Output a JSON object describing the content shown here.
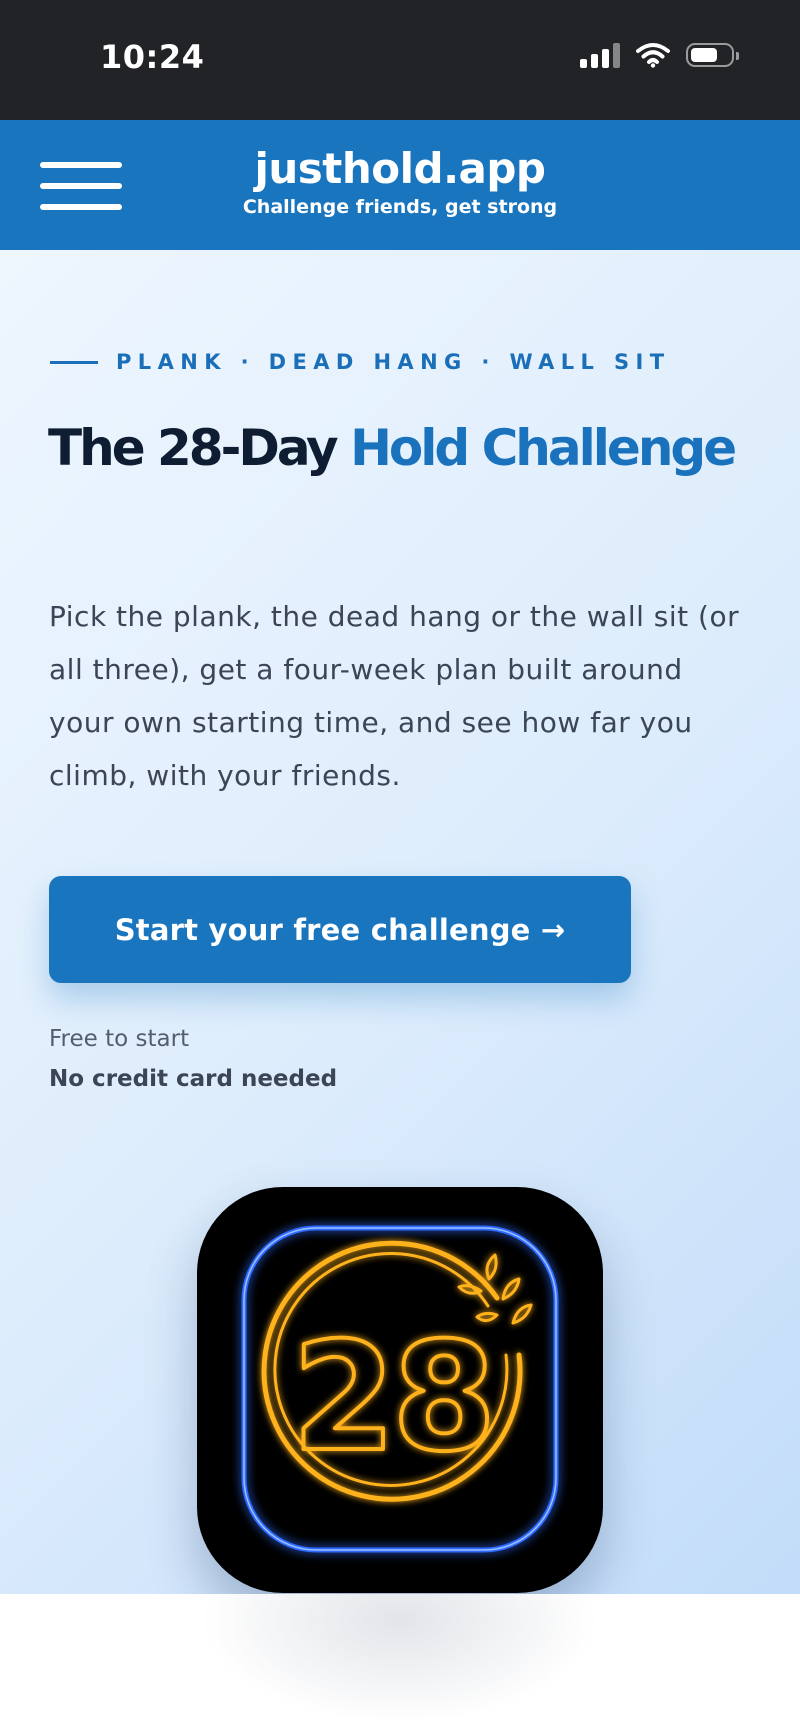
{
  "status_bar": {
    "time": "10:24"
  },
  "header": {
    "title": "justhold.app",
    "tagline": "Challenge friends, get strong",
    "background_color": "#1a75bf"
  },
  "hero": {
    "eyebrow": "PLANK · DEAD HANG · WALL SIT",
    "headline_part1": "The 28-Day",
    "headline_accent": "Hold Challenge",
    "description": "Pick the plank, the dead hang or the wall sit (or all three), get a four-week plan built around your own starting time, and see how far you climb, with your friends.",
    "cta_label": "Start your free challenge →",
    "note_primary": "Free to start",
    "note_secondary": "No credit card needed",
    "accent_color": "#1a72bd",
    "heading_color": "#0e1d32"
  },
  "app_icon": {
    "number": "28",
    "icon": "laurel-badge-icon",
    "frame_color": "#2f6bff",
    "badge_color": "#ffb21a"
  }
}
